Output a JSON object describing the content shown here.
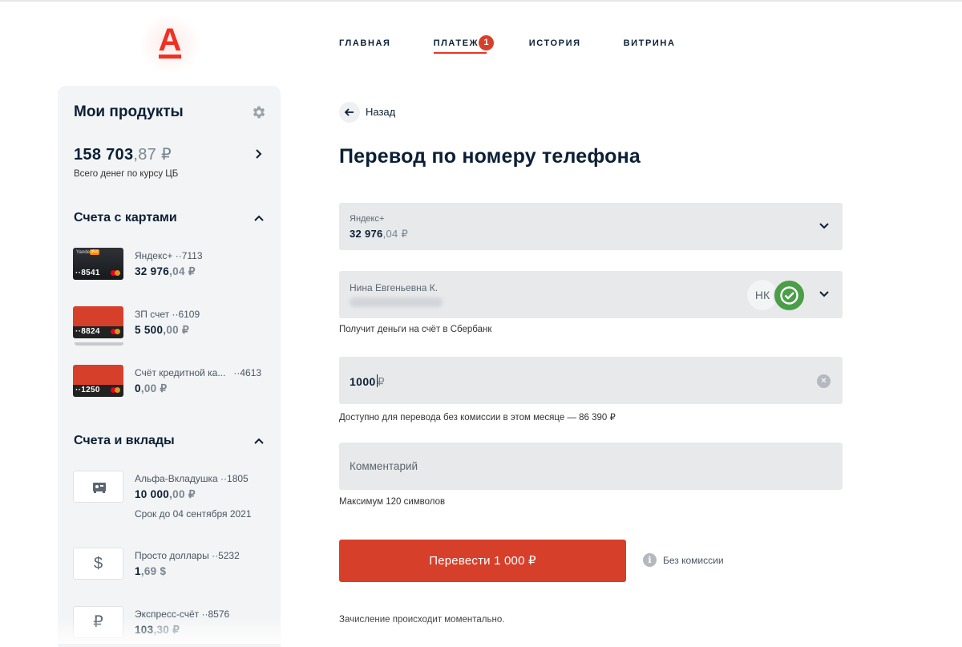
{
  "colors": {
    "brand": "#ef3124",
    "button": "#d6402b",
    "sber_green": "#4a9e47",
    "field_bg": "#e8e9eb",
    "sidebar_bg": "#f3f4f5"
  },
  "header": {
    "logo_letter": "А",
    "nav": [
      {
        "label": "ГЛАВНАЯ",
        "active": false
      },
      {
        "label": "ПЛАТЕЖИ",
        "active": true,
        "badge": "1"
      },
      {
        "label": "ИСТОРИЯ",
        "active": false
      },
      {
        "label": "ВИТРИНА",
        "active": false
      }
    ]
  },
  "sidebar": {
    "title": "Мои продукты",
    "total": {
      "int": "158 703",
      "frac": ",87",
      "cur": " ₽",
      "caption": "Всего денег по курсу ЦБ"
    },
    "cards_section": {
      "title": "Счета с картами",
      "items": [
        {
          "name": "Яндекс+",
          "suffix": "··7113",
          "bal_int": "32 976",
          "bal_frac": ",04",
          "cur": " ₽",
          "card_number": "··8541",
          "card_brand": "Yandex",
          "card_plus": "plus"
        },
        {
          "name": "ЗП счет",
          "suffix": "··6109",
          "bal_int": "5 500",
          "bal_frac": ",00",
          "cur": " ₽",
          "card_number": "··8824"
        },
        {
          "name": "Счёт кредитной ка...",
          "suffix": "··4613",
          "bal_int": "0",
          "bal_frac": ",00",
          "cur": " ₽",
          "card_number": "··1250"
        }
      ]
    },
    "deposits_section": {
      "title": "Счета и вклады",
      "items": [
        {
          "name": "Альфа-Вкладушка",
          "suffix": "··1805",
          "bal_int": "10 000",
          "bal_frac": ",00",
          "cur": " ₽",
          "sub": "Срок до 04 сентября 2021",
          "icon": "safe-icon"
        },
        {
          "name": "Просто доллары",
          "suffix": "··5232",
          "bal_int": "1",
          "bal_frac": ",69",
          "cur": " $",
          "icon": "dollar-icon",
          "glyph": "$"
        },
        {
          "name": "Экспресс-счёт",
          "suffix": "··8576",
          "bal_int": "103",
          "bal_frac": ",30",
          "cur": " ₽",
          "icon": "ruble-icon",
          "glyph": "₽"
        }
      ]
    }
  },
  "main": {
    "back_label": "Назад",
    "title": "Перевод по номеру телефона",
    "source": {
      "label": "Яндекс+",
      "int": "32 976",
      "frac": ",04",
      "cur": " ₽"
    },
    "recipient": {
      "name": "Нина Евгеньевна К.",
      "initials": "НК",
      "hint": "Получит деньги на счёт в Сбербанк"
    },
    "amount": {
      "value": "1000",
      "cur": "₽",
      "hint": "Доступно для перевода без комиссии в этом месяце — 86 390 ₽"
    },
    "comment": {
      "placeholder": "Комментарий",
      "hint": "Максимум 120 символов"
    },
    "submit_label": "Перевести 1 000 ₽",
    "fee_label": "Без комиссии",
    "footer_note": "Зачисление происходит моментально."
  }
}
